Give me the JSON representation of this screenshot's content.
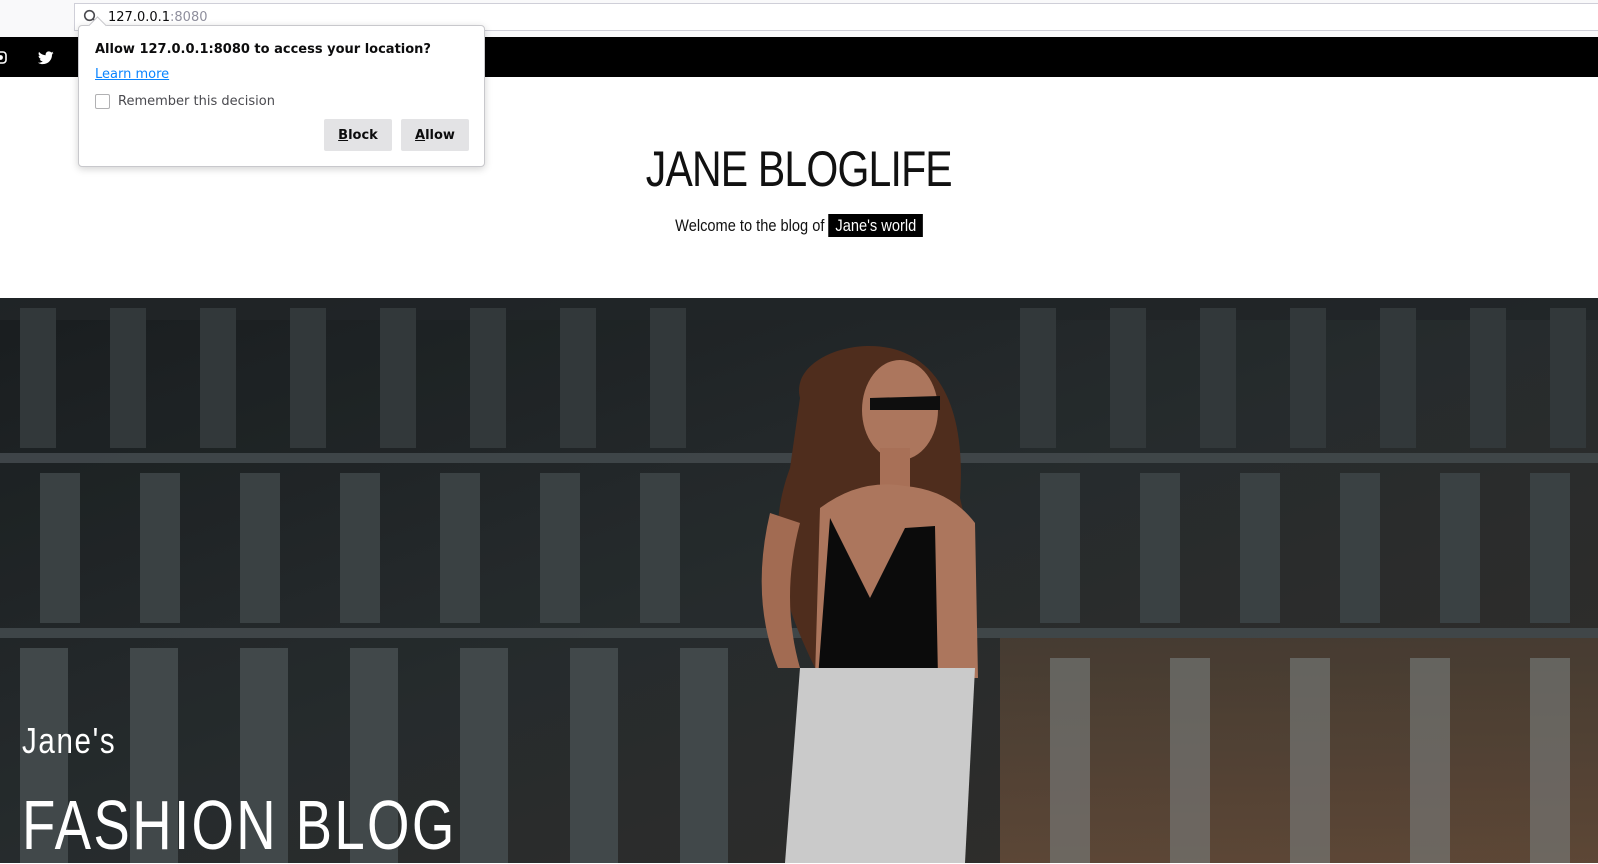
{
  "browser": {
    "url_host": "127.0.0.1",
    "url_port": ":8080"
  },
  "permission_popup": {
    "message": "Allow 127.0.0.1:8080 to access your location?",
    "learn_more": "Learn more",
    "remember_label": "Remember this decision",
    "block_accesskey": "B",
    "block_rest": "lock",
    "allow_accesskey": "A",
    "allow_rest": "llow"
  },
  "topbar": {
    "icons": [
      "instagram-icon",
      "twitter-icon"
    ]
  },
  "header": {
    "title": "JANE BLOGLIFE",
    "tagline_prefix": "Welcome to the blog of",
    "tagline_highlight": "Jane's world"
  },
  "hero": {
    "kicker": "Jane's",
    "title": "FASHION BLOG"
  },
  "colors": {
    "topbar": "#000000",
    "link": "#0a84ff",
    "button": "#e3e3e5"
  }
}
